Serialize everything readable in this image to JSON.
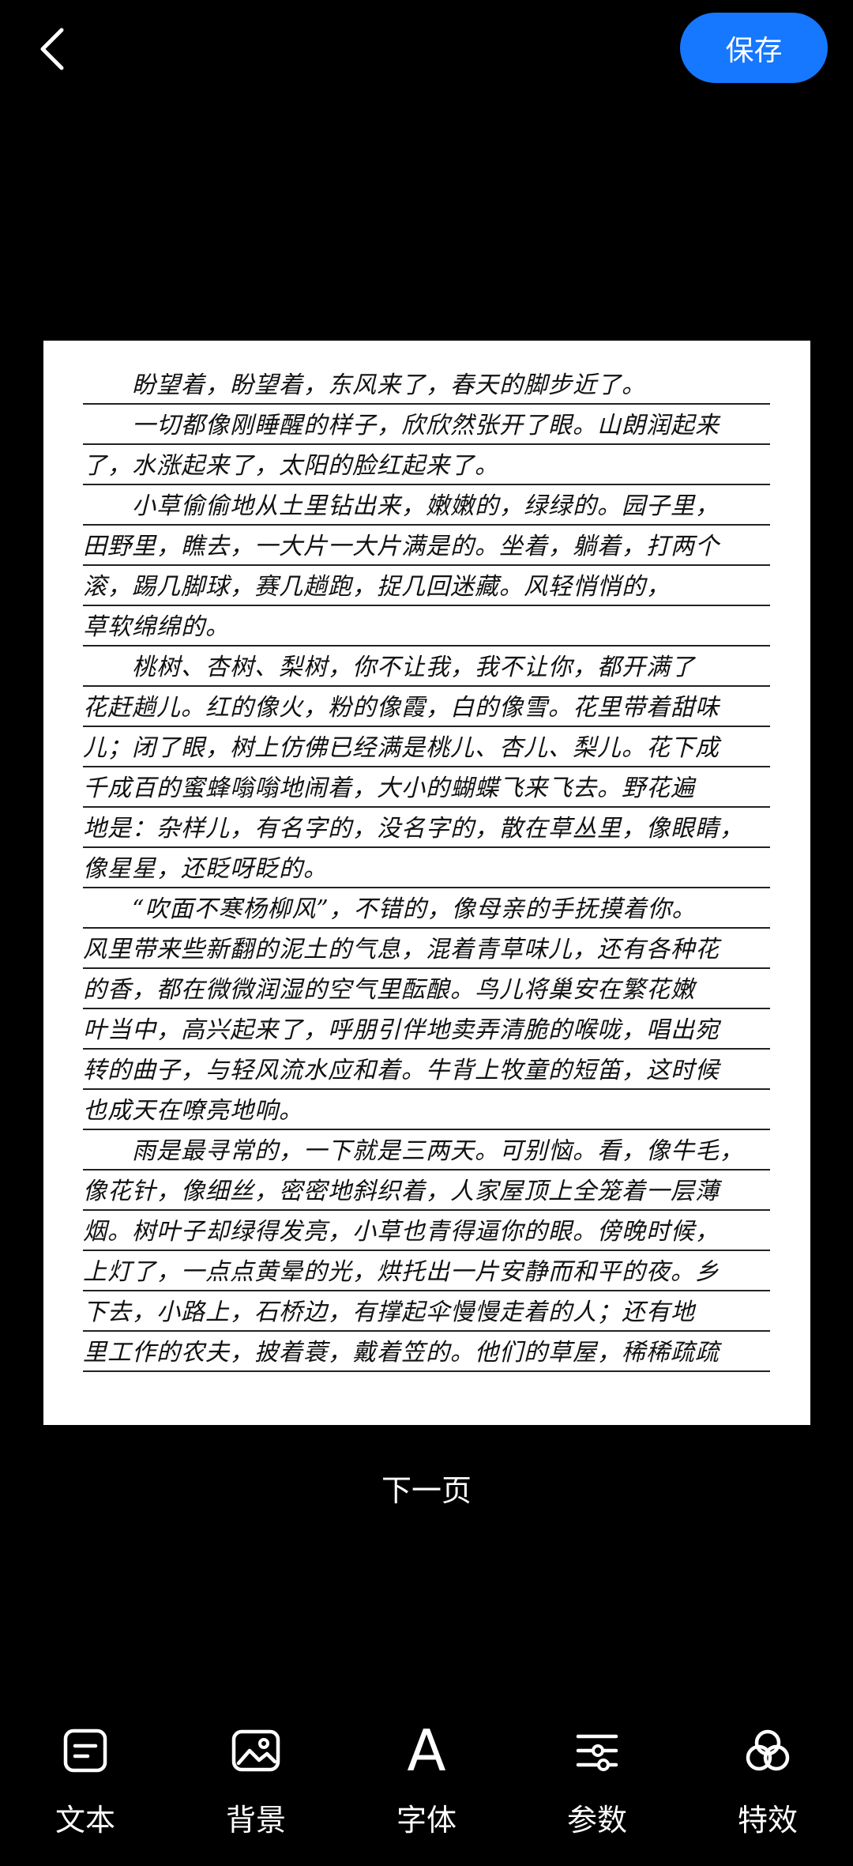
{
  "header": {
    "save_label": "保存"
  },
  "document": {
    "lines": [
      {
        "text": "盼望着，盼望着，东风来了，春天的脚步近了。",
        "indent": true
      },
      {
        "text": "一切都像刚睡醒的样子，欣欣然张开了眼。山朗润起来",
        "indent": true
      },
      {
        "text": "了，水涨起来了，太阳的脸红起来了。",
        "indent": false
      },
      {
        "text": "小草偷偷地从土里钻出来，嫩嫩的，绿绿的。园子里，",
        "indent": true
      },
      {
        "text": "田野里，瞧去，一大片一大片满是的。坐着，躺着，打两个",
        "indent": false
      },
      {
        "text": "滚，踢几脚球，赛几趟跑，捉几回迷藏。风轻悄悄的，",
        "indent": false
      },
      {
        "text": "草软绵绵的。",
        "indent": false
      },
      {
        "text": "桃树、杏树、梨树，你不让我，我不让你，都开满了",
        "indent": true
      },
      {
        "text": "花赶趟儿。红的像火，粉的像霞，白的像雪。花里带着甜味",
        "indent": false
      },
      {
        "text": "儿；闭了眼，树上仿佛已经满是桃儿、杏儿、梨儿。花下成",
        "indent": false
      },
      {
        "text": "千成百的蜜蜂嗡嗡地闹着，大小的蝴蝶飞来飞去。野花遍",
        "indent": false
      },
      {
        "text": "地是：杂样儿，有名字的，没名字的，散在草丛里，像眼睛，",
        "indent": false
      },
      {
        "text": "像星星，还眨呀眨的。",
        "indent": false
      },
      {
        "text": "“吹面不寒杨柳风”，不错的，像母亲的手抚摸着你。",
        "indent": true
      },
      {
        "text": "风里带来些新翻的泥土的气息，混着青草味儿，还有各种花",
        "indent": false
      },
      {
        "text": "的香，都在微微润湿的空气里酝酿。鸟儿将巢安在繁花嫩",
        "indent": false
      },
      {
        "text": "叶当中，高兴起来了，呼朋引伴地卖弄清脆的喉咙，唱出宛",
        "indent": false
      },
      {
        "text": "转的曲子，与轻风流水应和着。牛背上牧童的短笛，这时候",
        "indent": false
      },
      {
        "text": "也成天在嘹亮地响。",
        "indent": false
      },
      {
        "text": "雨是最寻常的，一下就是三两天。可别恼。看，像牛毛，",
        "indent": true
      },
      {
        "text": "像花针，像细丝，密密地斜织着，人家屋顶上全笼着一层薄",
        "indent": false
      },
      {
        "text": "烟。树叶子却绿得发亮，小草也青得逼你的眼。傍晚时候，",
        "indent": false
      },
      {
        "text": "上灯了，一点点黄晕的光，烘托出一片安静而和平的夜。乡",
        "indent": false
      },
      {
        "text": "下去，小路上，石桥边，有撑起伞慢慢走着的人；还有地",
        "indent": false
      },
      {
        "text": "里工作的农夫，披着蓑，戴着笠的。他们的草屋，稀稀疏疏",
        "indent": false
      }
    ]
  },
  "navigation": {
    "next_page_label": "下一页"
  },
  "toolbar": {
    "items": [
      {
        "id": "text",
        "label": "文本",
        "icon": "text-icon"
      },
      {
        "id": "background",
        "label": "背景",
        "icon": "image-icon"
      },
      {
        "id": "font",
        "label": "字体",
        "icon": "font-icon",
        "glyph": "A"
      },
      {
        "id": "params",
        "label": "参数",
        "icon": "sliders-icon"
      },
      {
        "id": "effects",
        "label": "特效",
        "icon": "effects-icon"
      }
    ]
  },
  "colors": {
    "accent": "#1677ff",
    "background": "#000000",
    "paper": "#ffffff"
  }
}
